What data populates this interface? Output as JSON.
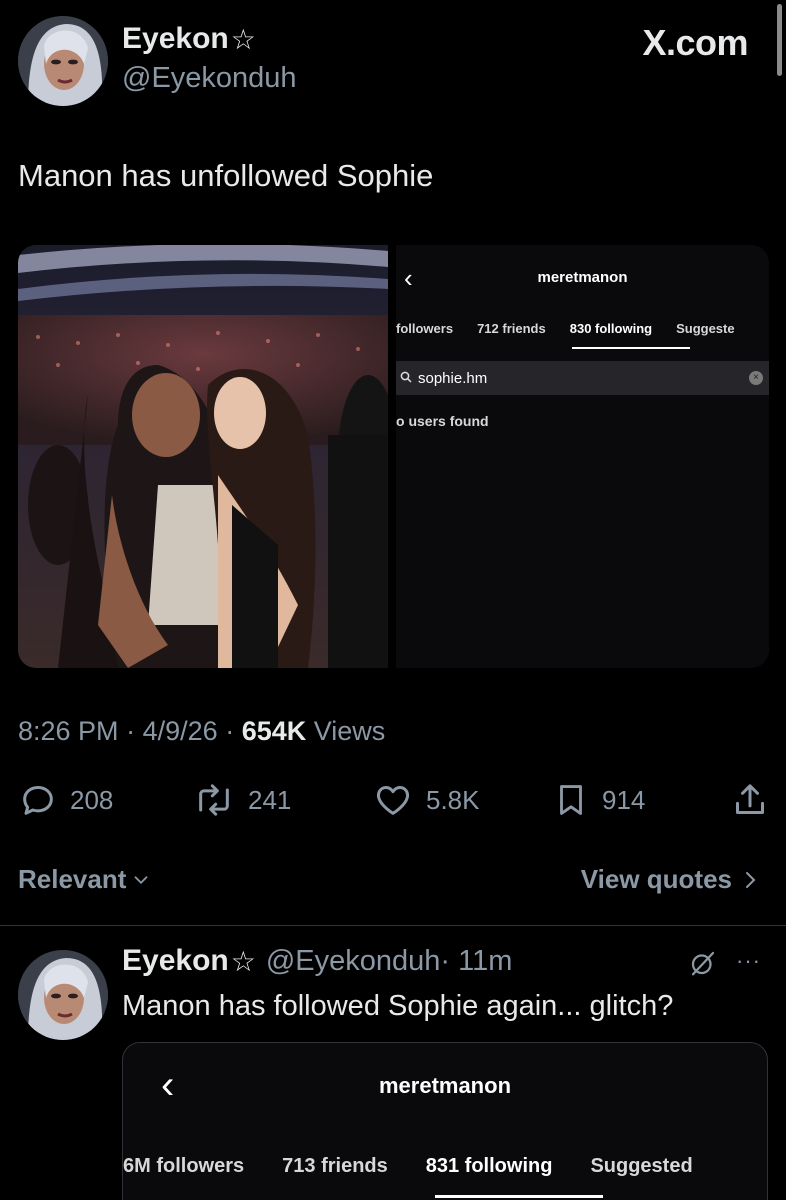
{
  "header": {
    "display_name": "Eyekon",
    "star_glyph": "☆",
    "handle": "@Eyekonduh",
    "site_label": "X.com"
  },
  "tweet": {
    "text": "Manon has unfollowed Sophie",
    "time": "8:26 PM",
    "date": "4/9/26",
    "views_count": "654K",
    "views_label": "Views",
    "separator": "·"
  },
  "instagram_panel": {
    "back_icon": "chevron-left-icon",
    "username": "meretmanon",
    "tabs": [
      "followers",
      "712 friends",
      "830 following",
      "Suggeste"
    ],
    "active_tab": "830 following",
    "search_value": "sophie.hm",
    "empty_message": "o users found"
  },
  "actions": {
    "replies": "208",
    "reposts": "241",
    "likes": "5.8K",
    "bookmarks": "914"
  },
  "filters": {
    "sort_label": "Relevant",
    "view_quotes_label": "View quotes"
  },
  "reply": {
    "display_name": "Eyekon",
    "star_glyph": "☆",
    "handle": "@Eyekonduh",
    "time": "· 11m",
    "text": "Manon has followed Sophie again... glitch?",
    "more_glyph": "···",
    "instagram_panel": {
      "username": "meretmanon",
      "tabs": [
        "6M followers",
        "713 friends",
        "831 following",
        "Suggested"
      ],
      "active_tab": "831 following"
    }
  },
  "colors": {
    "background": "#000000",
    "text_primary": "#e7e9ea",
    "text_secondary": "#8b98a5",
    "divider": "#2f3336"
  }
}
